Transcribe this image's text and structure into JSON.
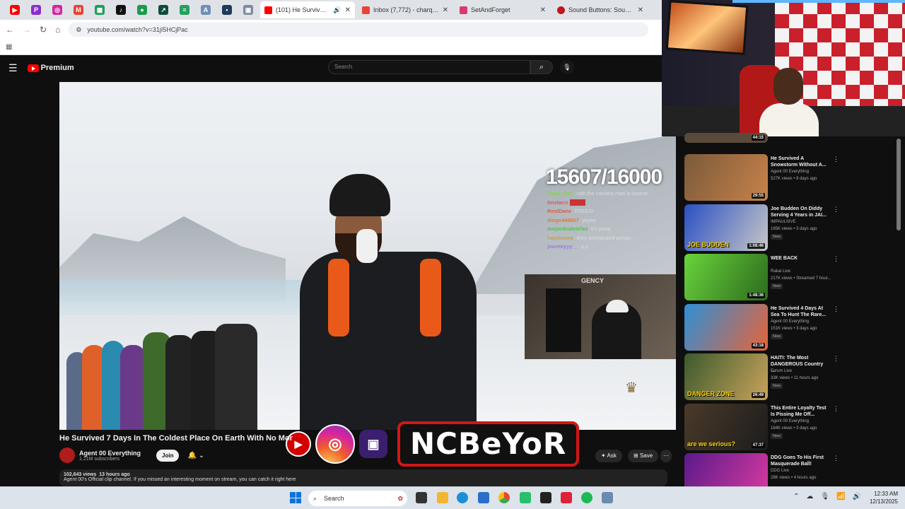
{
  "browser": {
    "tabs": [
      {
        "title": "(101) He Survived 7 D",
        "active": true,
        "color": "#ff0000"
      },
      {
        "title": "Inbox (7,772) - charqoalg",
        "active": false,
        "color": "#ea4335"
      },
      {
        "title": "SetAndForget",
        "active": false,
        "color": "#d93a6d"
      },
      {
        "title": "Sound Buttons: Sound B",
        "active": false,
        "color": "#c0161d"
      }
    ],
    "url": "youtube.com/watch?v=31jI5HCjPac"
  },
  "youtube": {
    "logo_text": "Premium",
    "search_placeholder": "Search"
  },
  "overlay": {
    "counter": "15607/16000",
    "chat": [
      {
        "name": "black_fury",
        "msg": "nah the camera man is insane"
      },
      {
        "name": "tinstarrz",
        "msg": ""
      },
      {
        "name": "RealDane",
        "msg": "TREES!"
      },
      {
        "name": "diego448667",
        "msg": "yeyes"
      },
      {
        "name": "mojordvaletzfan",
        "msg": "it's peop"
      },
      {
        "name": "handsome",
        "msg": "they dehydrated pengu"
      },
      {
        "name": "journeyyy__",
        "msg": "y y"
      }
    ],
    "cam_label": "GENCY",
    "brand_name": "NCBeYoR"
  },
  "video": {
    "title": "He Survived 7 Days In The Coldest Place On Earth With No Money...",
    "channel": "Agent 00 Everything",
    "subscribers": "1.21M subscribers",
    "join_label": "Join",
    "ask_label": "Ask",
    "save_label": "Save",
    "views": "102,643 views",
    "age": "13 hours ago",
    "description": "Agent 00's Official clip channel. If you missed an interesting moment on stream, you can catch it right here"
  },
  "sidebar": {
    "partial_duration": "44:15",
    "items": [
      {
        "title": "He Survived A Snowstorm Without A...",
        "channel": "Agent 00 Everything",
        "meta": "527K views • 8 days ago",
        "duration": "29:55",
        "badge": "",
        "colors": [
          "#7a5a3a",
          "#c8824a"
        ]
      },
      {
        "title": "Joe Budden On Diddy Serving 4 Years in JAI...",
        "channel": "IMPAULSIVE",
        "meta": "165K views • 3 days ago",
        "duration": "1:08:46",
        "badge": "New",
        "colors": [
          "#2a4fc4",
          "#c7c7c7"
        ],
        "label": "JOE BUDDEN"
      },
      {
        "title": "WEE BACK",
        "channel": "Rakai Live",
        "meta": "217K views • Streamed 7 hour...",
        "duration": "1:48:36",
        "badge": "New",
        "colors": [
          "#6ad33b",
          "#2c6b1e"
        ]
      },
      {
        "title": "He Survived 4 Days At Sea To Hunt The Rare...",
        "channel": "Agent 00 Everything",
        "meta": "151K views • 3 days ago",
        "duration": "43:18",
        "badge": "New",
        "colors": [
          "#2e8fd6",
          "#e6643a"
        ]
      },
      {
        "title": "HAITI: The Most DANGEROUS Country ...",
        "channel": "Forum Live",
        "meta": "33K views • 11 hours ago",
        "duration": "26:49",
        "badge": "New",
        "colors": [
          "#3b5a2c",
          "#c9a35b"
        ],
        "label": "DANGER ZONE"
      },
      {
        "title": "This Entire Loyalty Test Is Pissing Me Off...",
        "channel": "Agent 00 Everything",
        "meta": "164K views • 3 days ago",
        "duration": "47:37",
        "badge": "New",
        "colors": [
          "#4a3a2a",
          "#1c1c1c"
        ],
        "label": "are we serious?"
      },
      {
        "title": "DDG Goes To His First Masquerade Ball!",
        "channel": "DDG Live",
        "meta": "28K views • 4 hours ago",
        "duration": "",
        "badge": "",
        "colors": [
          "#5a1a8a",
          "#d93aa0"
        ]
      }
    ]
  },
  "taskbar": {
    "search_placeholder": "Search",
    "time": "12:33 AM",
    "date": "12/13/2025"
  }
}
